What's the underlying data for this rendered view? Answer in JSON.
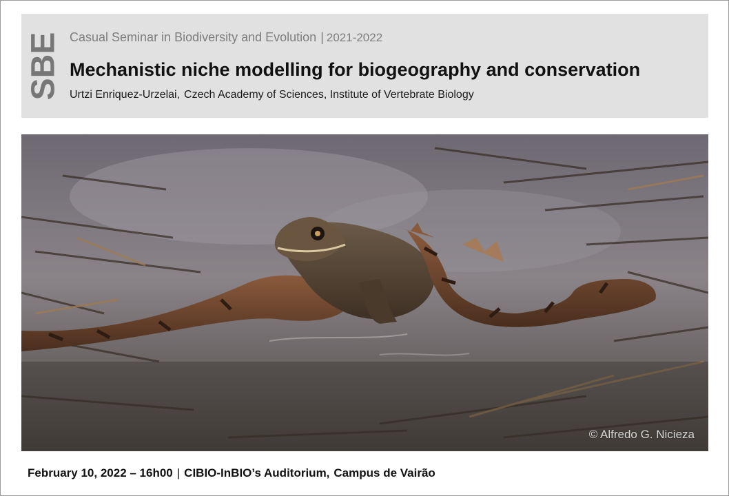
{
  "header": {
    "logo_text": "SBE",
    "series": "Casual Seminar in Biodiversity and Evolution",
    "separator": "|",
    "year": "2021-2022",
    "title": "Mechanistic niche modelling for biogeography and conservation",
    "speaker_name": "Urtzi Enriquez-Urzelai,",
    "speaker_affiliation": "Czech Academy of Sciences, Institute of Vertebrate Biology"
  },
  "photo": {
    "credit": "© Alfredo G. Nicieza"
  },
  "footer": {
    "datetime": "February 10, 2022 – 16h00",
    "separator": "|",
    "venue": "CIBIO-InBIO’s Auditorium,",
    "campus": "Campus de Vairão"
  }
}
